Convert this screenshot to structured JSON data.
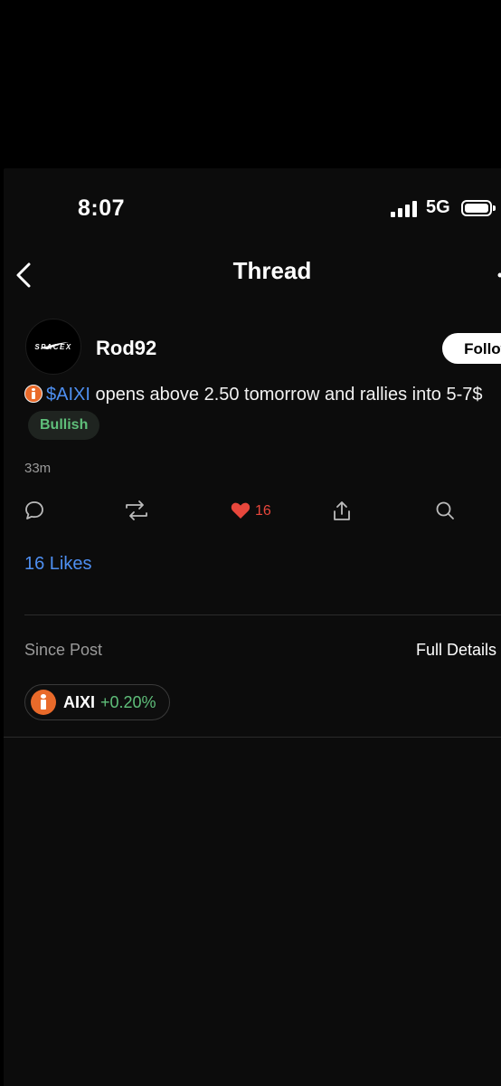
{
  "status_bar": {
    "time": "8:07",
    "network": "5G"
  },
  "nav": {
    "title": "Thread"
  },
  "post": {
    "avatar_text": "SPACEX",
    "username": "Rod92",
    "follow_label": "Follow",
    "cashtag": "$AIXI",
    "text": " opens above 2.50 tomorrow and rallies into 5-7$",
    "sentiment": "Bullish",
    "timestamp": "33m",
    "like_count": "16",
    "likes_link": "16 Likes"
  },
  "since_post": {
    "label": "Since Post",
    "full_details": "Full Details",
    "symbol": "AIXI",
    "change": "+0.20%"
  },
  "colors": {
    "accent_blue": "#4e8ff1",
    "bullish_green": "#5fbf7a",
    "like_red": "#e8473c",
    "ticker_orange": "#e96a2a"
  }
}
